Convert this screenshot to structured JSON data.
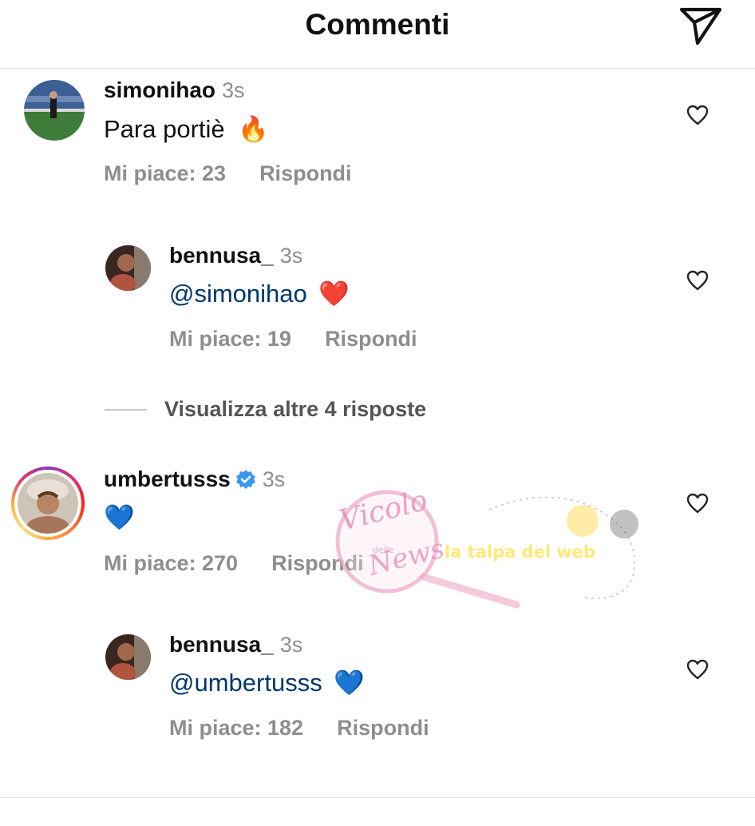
{
  "header": {
    "title": "Commenti",
    "send_icon": "paper-plane-icon"
  },
  "comments": [
    {
      "username": "simonihao",
      "time": "3s",
      "text": "Para portiè",
      "emoji": "🔥",
      "likes_label": "Mi piace: 23",
      "reply_label": "Rispondi",
      "verified": false
    },
    {
      "username": "bennusa_",
      "time": "3s",
      "mention": "@simonihao",
      "emoji": "❤️",
      "likes_label": "Mi piace: 19",
      "reply_label": "Rispondi",
      "is_reply": true
    },
    {
      "username": "umbertusss",
      "time": "3s",
      "emoji": "💙",
      "likes_label": "Mi piace: 270",
      "reply_label": "Rispondi",
      "verified": true,
      "story_ring": true
    },
    {
      "username": "bennusa_",
      "time": "3s",
      "mention": "@umbertusss",
      "emoji": "💙",
      "likes_label": "Mi piace: 182",
      "reply_label": "Rispondi",
      "is_reply": true
    }
  ],
  "view_more": {
    "label": "Visualizza altre 4 risposte"
  },
  "watermark": {
    "text1": "Vicolo",
    "text2": "delle",
    "text3": "News",
    "text4": "la talpa del web"
  },
  "colors": {
    "mention": "#00376b",
    "secondary_text": "#8e8e8e",
    "verified": "#3897f0"
  }
}
